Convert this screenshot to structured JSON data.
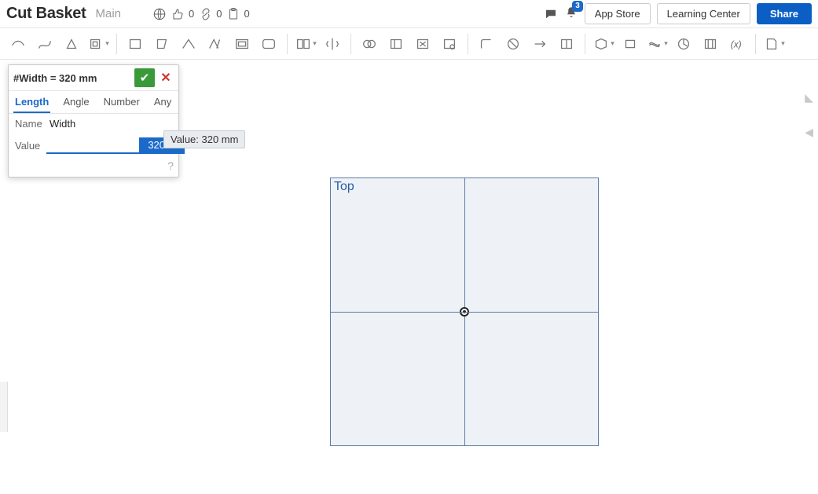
{
  "doc": {
    "title": "Cut Basket",
    "branch": "Main"
  },
  "header": {
    "stats": {
      "thumbs": "0",
      "links": "0",
      "clipboard": "0"
    },
    "notification_count": "3",
    "buttons": {
      "app_store": "App Store",
      "learning": "Learning Center",
      "share": "Share"
    }
  },
  "toolbar_tools": [
    "line-tool",
    "spline-tool",
    "conic-tool",
    "offset-tool",
    "rect-tool",
    "polygon-tool",
    "point-tool",
    "text-tool",
    "slot-tool",
    "ellipse-tool",
    "image-tool",
    "pattern-tool",
    "mirror-tool",
    "bool1-tool",
    "bool2-tool",
    "bool3-tool",
    "bool4-tool",
    "fillet-tool",
    "trim-tool",
    "extend-tool",
    "split-tool",
    "plane-tool",
    "box-tool",
    "sweep-tool",
    "revolve-tool",
    "loft-tool",
    "fx-tool",
    "sheet-tool"
  ],
  "variable_dialog": {
    "expression": "#Width = 320 mm",
    "tabs": [
      "Length",
      "Angle",
      "Number",
      "Any"
    ],
    "active_tab": 0,
    "name_label": "Name",
    "name_value": "Width",
    "value_label": "Value",
    "value_input": "320 mm",
    "tooltip": "Value: 320 mm"
  },
  "view": {
    "label": "Top"
  }
}
